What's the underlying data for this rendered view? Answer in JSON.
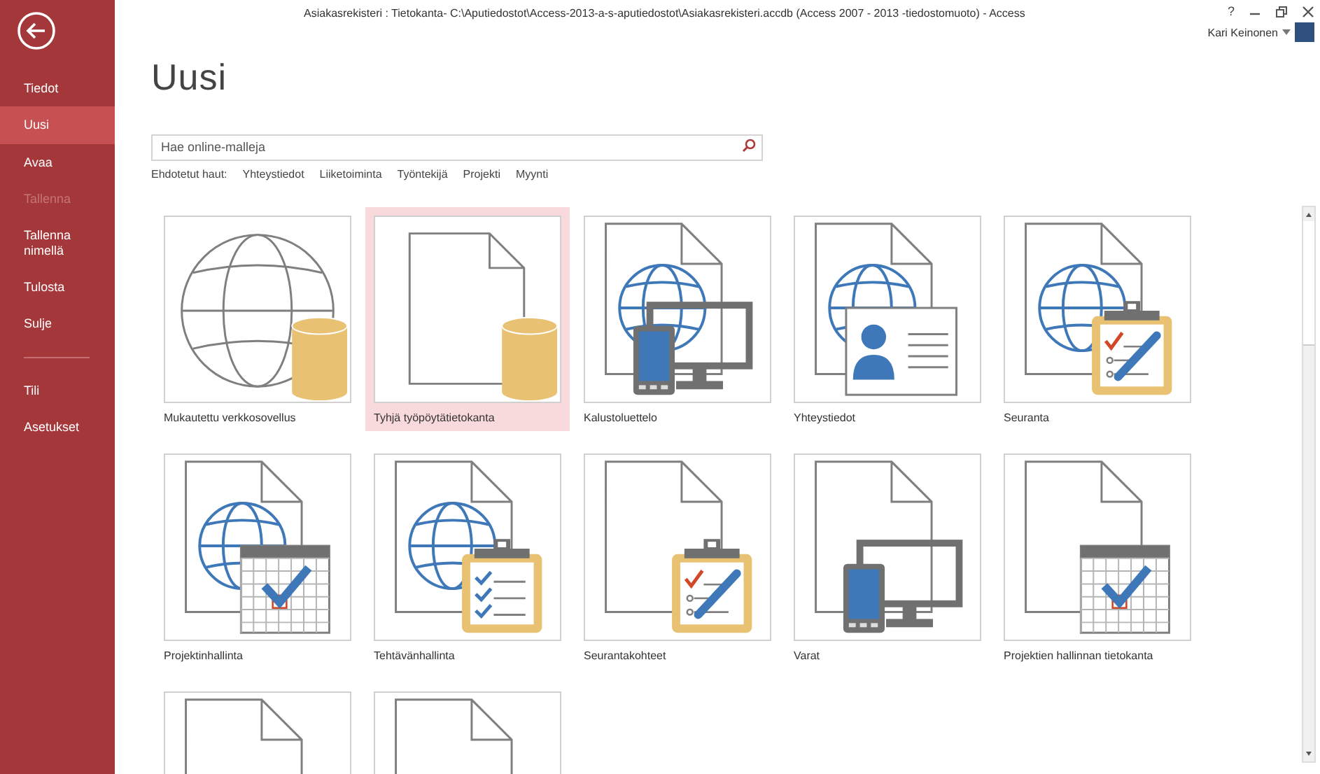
{
  "window": {
    "title": "Asiakasrekisteri : Tietokanta- C:\\Aputiedostot\\Access-2013-a-s-aputiedostot\\Asiakasrekisteri.accdb (Access 2007 - 2013 -tiedostomuoto)  - Access",
    "help": "?",
    "user": "Kari Keinonen"
  },
  "sidebar": {
    "items": [
      {
        "label": "Tiedot",
        "selected": false,
        "disabled": false
      },
      {
        "label": "Uusi",
        "selected": true,
        "disabled": false
      },
      {
        "label": "Avaa",
        "selected": false,
        "disabled": false
      },
      {
        "label": "Tallenna",
        "selected": false,
        "disabled": true
      },
      {
        "label": "Tallenna nimellä",
        "selected": false,
        "disabled": false
      },
      {
        "label": "Tulosta",
        "selected": false,
        "disabled": false
      },
      {
        "label": "Sulje",
        "selected": false,
        "disabled": false
      },
      {
        "kind": "divider"
      },
      {
        "label": "Tili",
        "selected": false,
        "disabled": false
      },
      {
        "label": "Asetukset",
        "selected": false,
        "disabled": false
      }
    ]
  },
  "heading": "Uusi",
  "search": {
    "placeholder": "Hae online-malleja"
  },
  "suggested": {
    "label": "Ehdotetut haut:",
    "links": [
      "Yhteystiedot",
      "Liiketoiminta",
      "Työntekijä",
      "Projekti",
      "Myynti"
    ]
  },
  "templates": [
    {
      "label": "Mukautettu verkkosovellus",
      "selected": false,
      "kind": "webapp"
    },
    {
      "label": "Tyhjä työpöytätietokanta",
      "selected": true,
      "kind": "blankdb"
    },
    {
      "label": "Kalustoluettelo",
      "selected": false,
      "kind": "webdevices"
    },
    {
      "label": "Yhteystiedot",
      "selected": false,
      "kind": "webcontact"
    },
    {
      "label": "Seuranta",
      "selected": false,
      "kind": "webissues"
    },
    {
      "label": "Projektinhallinta",
      "selected": false,
      "kind": "webcalendar"
    },
    {
      "label": "Tehtävänhallinta",
      "selected": false,
      "kind": "webtasks"
    },
    {
      "label": "Seurantakohteet",
      "selected": false,
      "kind": "issues"
    },
    {
      "label": "Varat",
      "selected": false,
      "kind": "devices"
    },
    {
      "label": "Projektien hallinnan tietokanta",
      "selected": false,
      "kind": "calendar"
    },
    {
      "selected": false,
      "kind": "document"
    },
    {
      "selected": false,
      "kind": "document"
    }
  ]
}
